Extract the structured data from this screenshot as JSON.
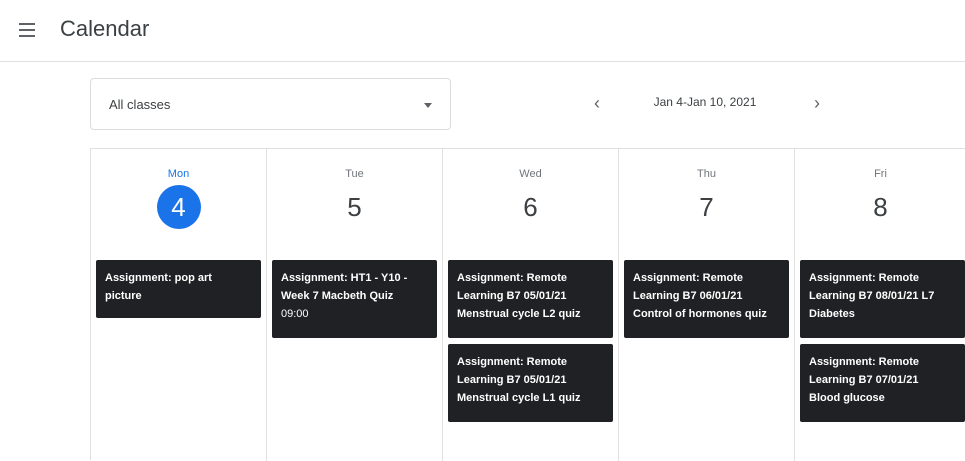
{
  "header": {
    "title": "Calendar"
  },
  "filter": {
    "selected": "All classes"
  },
  "week_nav": {
    "prev": "‹",
    "range": "Jan 4-Jan 10, 2021",
    "next": "›"
  },
  "days": [
    {
      "name": "Mon",
      "num": "4",
      "today": true
    },
    {
      "name": "Tue",
      "num": "5"
    },
    {
      "name": "Wed",
      "num": "6"
    },
    {
      "name": "Thu",
      "num": "7"
    },
    {
      "name": "Fri",
      "num": "8"
    }
  ],
  "assignments": {
    "mon_1": {
      "line1": "Assignment: pop art",
      "line2": "picture"
    },
    "tue_1": {
      "line1": "Assignment: HT1 - Y10 -",
      "line2": "Week 7 Macbeth Quiz",
      "time": "09:00"
    },
    "wed_1": {
      "line1": "Assignment: Remote",
      "line2": "Learning B7 05/01/21",
      "line3": "Menstrual cycle L2 quiz"
    },
    "wed_2": {
      "line1": "Assignment: Remote",
      "line2": "Learning B7 05/01/21",
      "line3": "Menstrual cycle L1 quiz"
    },
    "thu_1": {
      "line1": "Assignment: Remote",
      "line2": "Learning B7 06/01/21",
      "line3": "Control of hormones quiz"
    },
    "fri_1": {
      "line1": "Assignment: Remote",
      "line2": "Learning B7 08/01/21 L7",
      "line3": "Diabetes"
    },
    "fri_2": {
      "line1": "Assignment: Remote",
      "line2": "Learning B7 07/01/21",
      "line3": "Blood glucose"
    }
  }
}
